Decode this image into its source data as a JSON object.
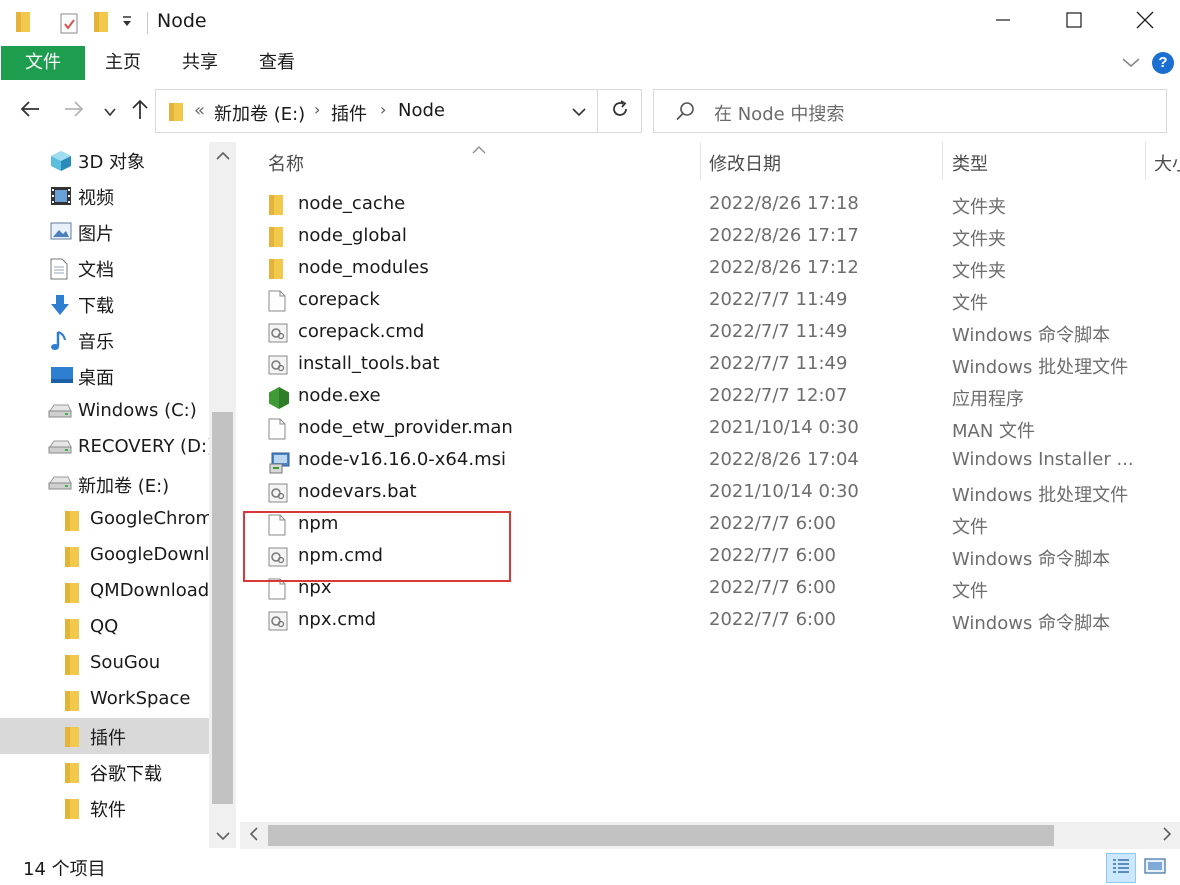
{
  "window": {
    "title": "Node",
    "minimize_icon": "minimize-icon",
    "maximize_icon": "maximize-icon",
    "close_icon": "close-icon"
  },
  "ribbon": {
    "tabs": [
      "文件",
      "主页",
      "共享",
      "查看"
    ]
  },
  "address": {
    "overflow": "«",
    "parts": [
      "新加卷 (E:)",
      "插件",
      "Node"
    ]
  },
  "search": {
    "placeholder": "在 Node 中搜索"
  },
  "navpane": {
    "items": [
      {
        "label": "3D 对象",
        "icon": "3d-objects-icon"
      },
      {
        "label": "视频",
        "icon": "video-icon"
      },
      {
        "label": "图片",
        "icon": "pictures-icon"
      },
      {
        "label": "文档",
        "icon": "documents-icon"
      },
      {
        "label": "下载",
        "icon": "download-icon"
      },
      {
        "label": "音乐",
        "icon": "music-icon"
      },
      {
        "label": "桌面",
        "icon": "desktop-icon"
      },
      {
        "label": "Windows (C:)",
        "icon": "drive-icon"
      },
      {
        "label": "RECOVERY (D:)",
        "icon": "drive-icon"
      },
      {
        "label": "新加卷 (E:)",
        "icon": "drive-icon"
      },
      {
        "label": "GoogleChrom",
        "icon": "folder-icon"
      },
      {
        "label": "GoogleDownl",
        "icon": "folder-icon"
      },
      {
        "label": "QMDownload",
        "icon": "folder-icon"
      },
      {
        "label": "QQ",
        "icon": "folder-icon"
      },
      {
        "label": "SouGou",
        "icon": "folder-icon"
      },
      {
        "label": "WorkSpace",
        "icon": "folder-icon"
      },
      {
        "label": "插件",
        "icon": "folder-icon",
        "selected": true
      },
      {
        "label": "谷歌下载",
        "icon": "folder-icon"
      },
      {
        "label": "软件",
        "icon": "folder-icon"
      }
    ]
  },
  "columns": {
    "name": "名称",
    "date": "修改日期",
    "type": "类型",
    "size": "大小"
  },
  "files": [
    {
      "name": "node_cache",
      "date": "2022/8/26 17:18",
      "type": "文件夹",
      "icon": "folder-icon"
    },
    {
      "name": "node_global",
      "date": "2022/8/26 17:17",
      "type": "文件夹",
      "icon": "folder-icon"
    },
    {
      "name": "node_modules",
      "date": "2022/8/26 17:12",
      "type": "文件夹",
      "icon": "folder-icon"
    },
    {
      "name": "corepack",
      "date": "2022/7/7 11:49",
      "type": "文件",
      "icon": "file-icon"
    },
    {
      "name": "corepack.cmd",
      "date": "2022/7/7 11:49",
      "type": "Windows 命令脚本",
      "icon": "script-icon"
    },
    {
      "name": "install_tools.bat",
      "date": "2022/7/7 11:49",
      "type": "Windows 批处理文件",
      "icon": "script-icon"
    },
    {
      "name": "node.exe",
      "date": "2022/7/7 12:07",
      "type": "应用程序",
      "icon": "node-app-icon"
    },
    {
      "name": "node_etw_provider.man",
      "date": "2021/10/14 0:30",
      "type": "MAN 文件",
      "icon": "file-icon"
    },
    {
      "name": "node-v16.16.0-x64.msi",
      "date": "2022/8/26 17:04",
      "type": "Windows Installer ...",
      "icon": "installer-icon"
    },
    {
      "name": "nodevars.bat",
      "date": "2021/10/14 0:30",
      "type": "Windows 批处理文件",
      "icon": "script-icon"
    },
    {
      "name": "npm",
      "date": "2022/7/7 6:00",
      "type": "文件",
      "icon": "file-icon"
    },
    {
      "name": "npm.cmd",
      "date": "2022/7/7 6:00",
      "type": "Windows 命令脚本",
      "icon": "script-icon"
    },
    {
      "name": "npx",
      "date": "2022/7/7 6:00",
      "type": "文件",
      "icon": "file-icon"
    },
    {
      "name": "npx.cmd",
      "date": "2022/7/7 6:00",
      "type": "Windows 命令脚本",
      "icon": "script-icon"
    }
  ],
  "status": {
    "count": "14 个项目"
  },
  "colors": {
    "file_tab": "#1e9d4f",
    "highlight": "#d9383a",
    "folder": "#f2c94c",
    "help": "#1b6fd1"
  }
}
